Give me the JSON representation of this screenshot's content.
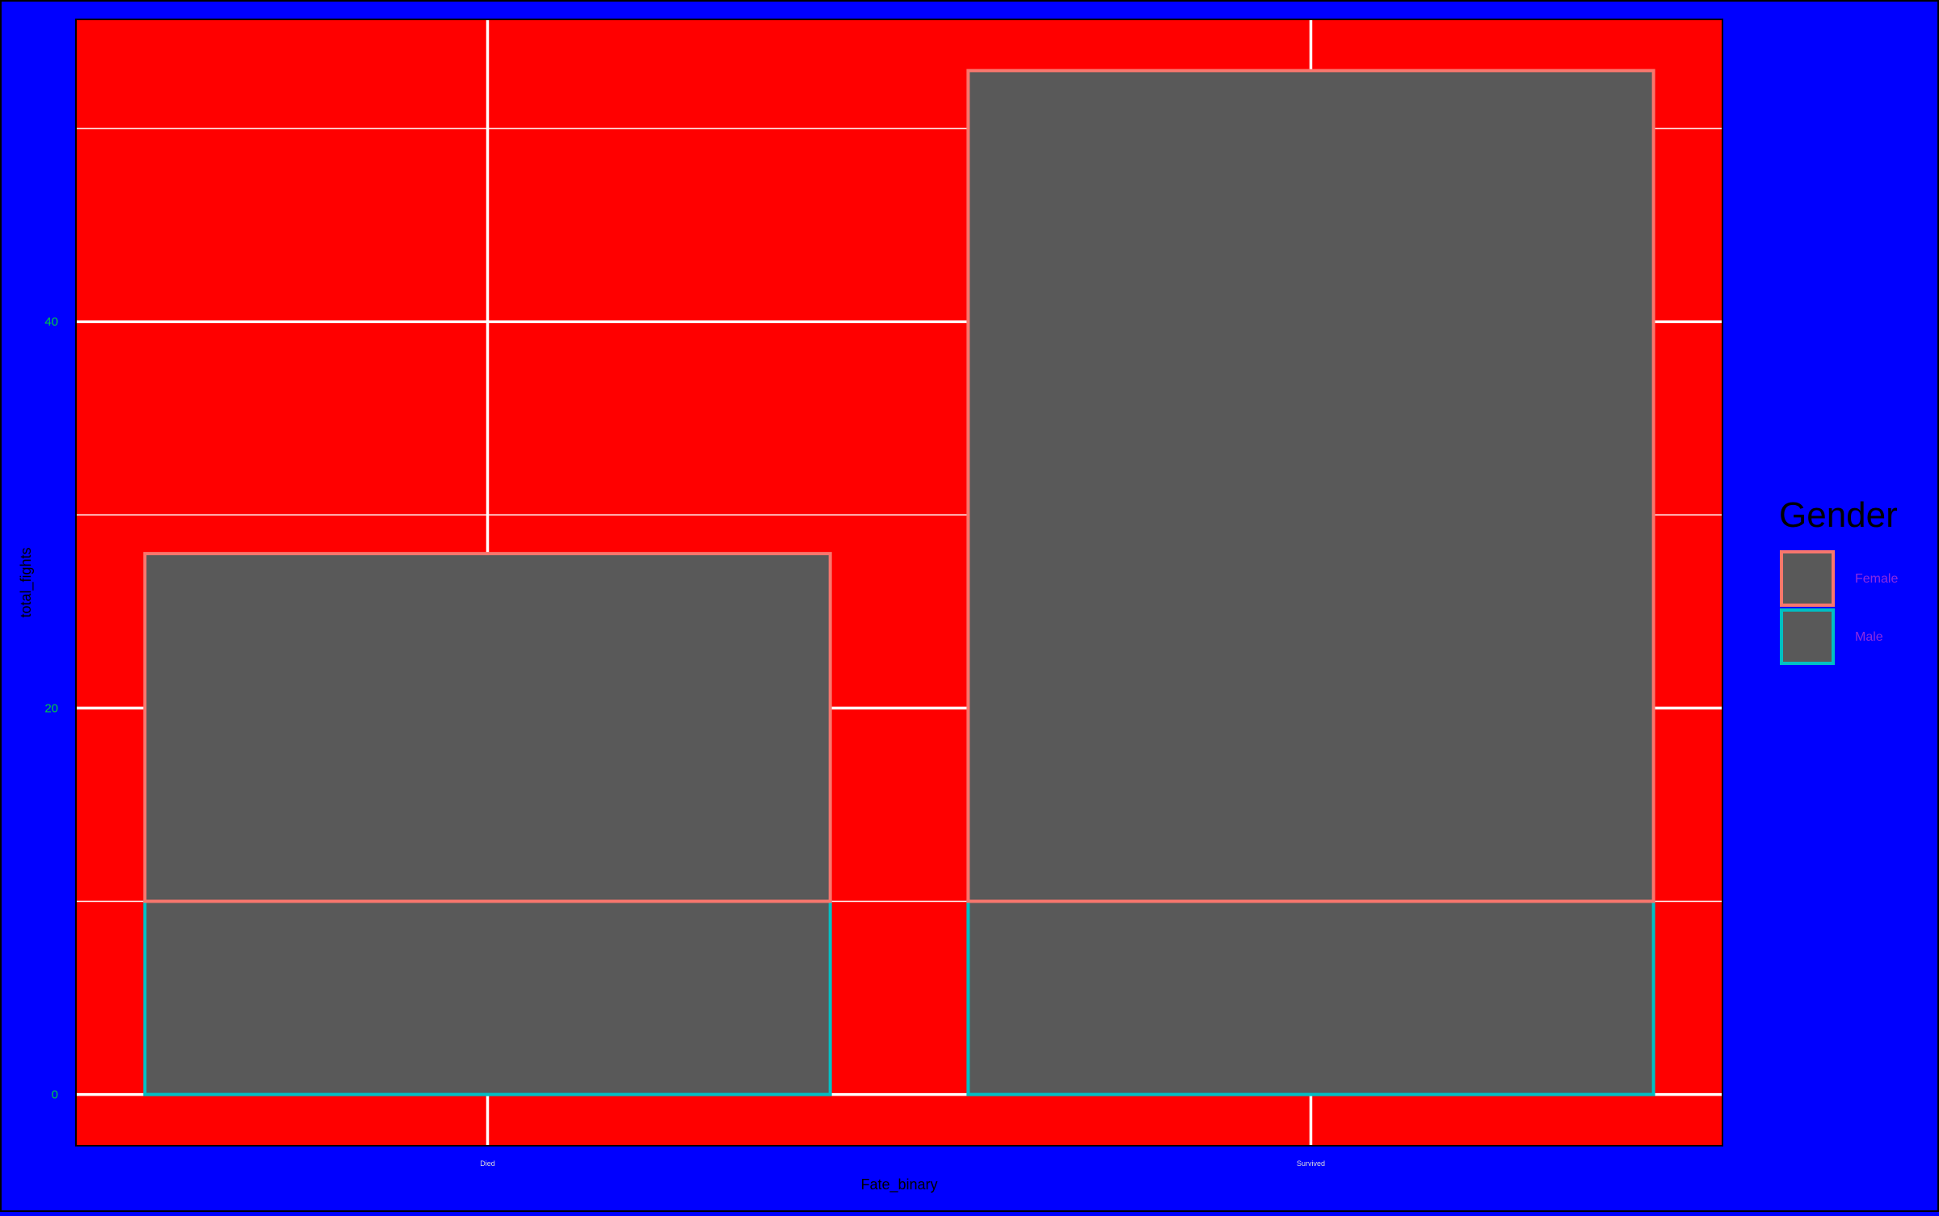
{
  "chart_data": {
    "type": "bar",
    "stacked": true,
    "categories": [
      "Died",
      "Survived"
    ],
    "series": [
      {
        "name": "Male",
        "values": [
          10,
          10
        ],
        "fill": "#595959",
        "outline": "#00bfc4"
      },
      {
        "name": "Female",
        "values": [
          18,
          43
        ],
        "fill": "#595959",
        "outline": "#f8766d"
      }
    ],
    "totals": [
      28,
      53
    ],
    "xlabel": "Fate_binary",
    "ylabel": "total_fights",
    "yticks": [
      0,
      20,
      40
    ],
    "ylim": [
      -2.65,
      55.65
    ],
    "grid": true,
    "legend": {
      "title": "Gender",
      "position": "right",
      "labels": [
        "Female",
        "Male"
      ]
    },
    "colors": {
      "page_background": "#0000ff",
      "panel_background": "#ff0000",
      "grid": "#ffffff",
      "bar_fill": "#595959",
      "female_outline": "#f8766d",
      "male_outline": "#00bfc4",
      "y_tick_labels": "#00cc44",
      "legend_labels": "#8a2be2",
      "axis_titles": "#000000"
    }
  }
}
